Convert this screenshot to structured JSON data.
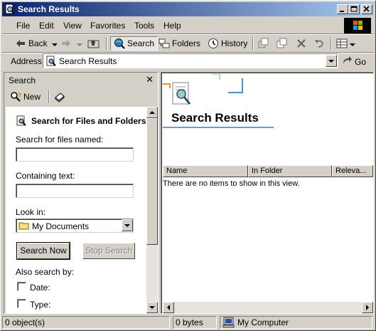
{
  "window": {
    "title": "Search Results"
  },
  "menu": {
    "items": [
      "File",
      "Edit",
      "View",
      "Favorites",
      "Tools",
      "Help"
    ]
  },
  "toolbar": {
    "back_label": "Back",
    "search_label": "Search",
    "folders_label": "Folders",
    "history_label": "History"
  },
  "address": {
    "label": "Address",
    "value": "Search Results",
    "go_label": "Go"
  },
  "search_pane": {
    "title": "Search",
    "new_label": "New",
    "heading": "Search for Files and Folders",
    "named_label": "Search for files named:",
    "named_value": "",
    "containing_label": "Containing text:",
    "containing_value": "",
    "lookin_label": "Look in:",
    "lookin_value": "My Documents",
    "search_now_label": "Search Now",
    "stop_search_label": "Stop Search",
    "also_label": "Also search by:",
    "options": [
      "Date:",
      "Type:"
    ]
  },
  "results": {
    "title": "Search Results",
    "columns": [
      "Name",
      "In Folder",
      "Releva..."
    ],
    "empty_message": "There are no items to show in this view."
  },
  "status": {
    "objects": "0 object(s)",
    "size": "0 bytes",
    "zone": "My Computer"
  },
  "colors": {
    "titlebar_start": "#0a246a",
    "titlebar_end": "#a6caf0",
    "face": "#d4d0c8"
  }
}
